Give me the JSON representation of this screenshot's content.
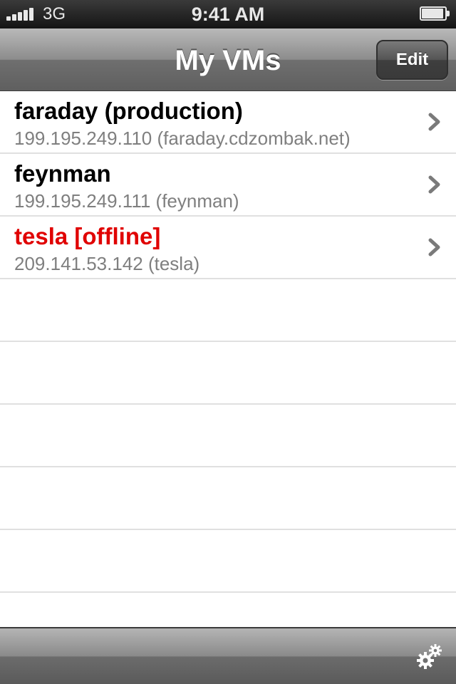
{
  "status_bar": {
    "network": "3G",
    "time": "9:41 AM",
    "signal_icon": "signal-bars-icon",
    "battery_icon": "battery-icon",
    "battery_level": 1.0
  },
  "nav_bar": {
    "title": "My VMs",
    "edit_label": "Edit"
  },
  "vms": [
    {
      "name": "faraday (production)",
      "detail": "199.195.249.110 (faraday.cdzombak.net)",
      "status": "online"
    },
    {
      "name": "feynman",
      "detail": "199.195.249.111 (feynman)",
      "status": "online"
    },
    {
      "name": "tesla [offline]",
      "detail": "209.141.53.142 (tesla)",
      "status": "offline"
    }
  ],
  "toolbar": {
    "settings_icon": "gears-icon"
  },
  "colors": {
    "offline_name": "#e00000",
    "detail_text": "#7f7f7f",
    "row_separator": "#e0e0e0"
  }
}
